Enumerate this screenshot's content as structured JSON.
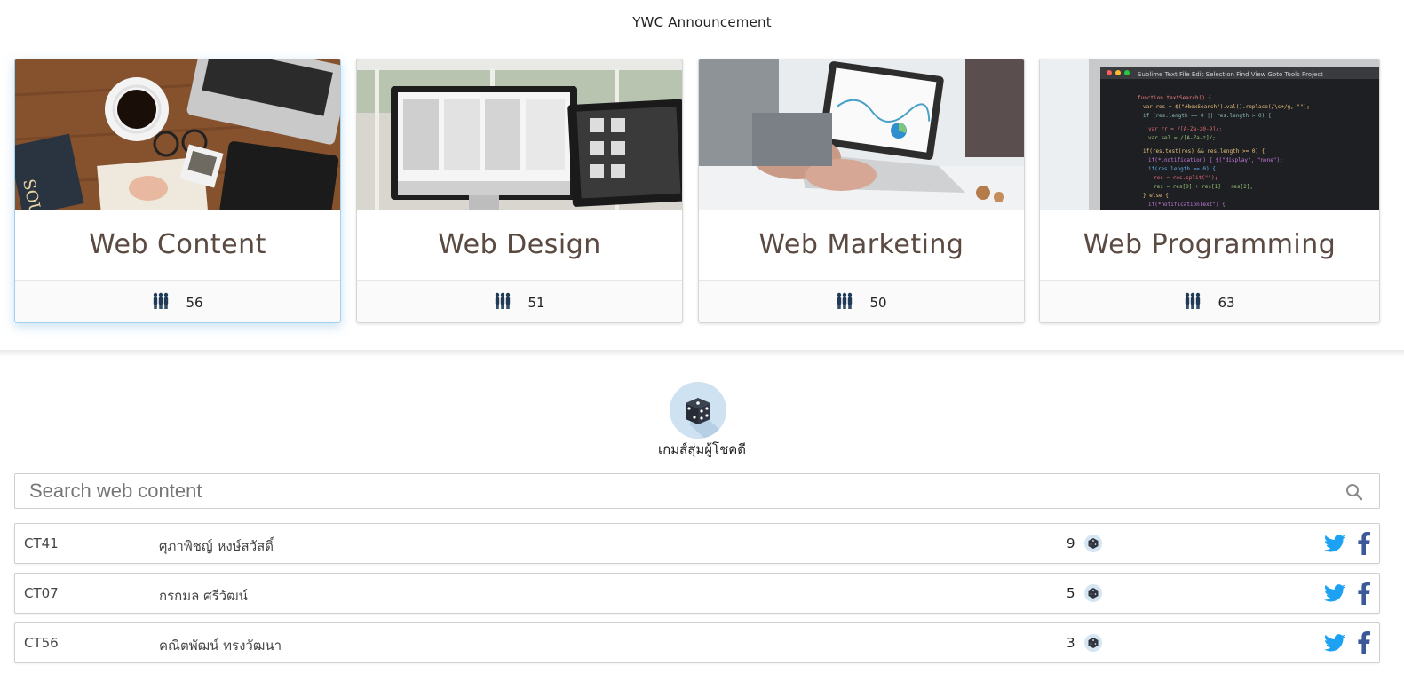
{
  "header": {
    "title": "YWC Announcement"
  },
  "majors": [
    {
      "name": "Web Content",
      "count": "56",
      "icon": "people-icon"
    },
    {
      "name": "Web Design",
      "count": "51",
      "icon": "people-icon"
    },
    {
      "name": "Web Marketing",
      "count": "50",
      "icon": "people-icon"
    },
    {
      "name": "Web Programming",
      "count": "63",
      "icon": "people-icon"
    }
  ],
  "random_game": {
    "label": "เกมส์สุ่มผู้โชคดี",
    "icon": "dice-icon"
  },
  "search": {
    "placeholder": "Search web content",
    "value": "",
    "icon": "search-icon"
  },
  "candidates": [
    {
      "id": "CT41",
      "name": "ศุภาพิชญ์ หงษ์สวัสดิ์",
      "score": "9"
    },
    {
      "id": "CT07",
      "name": "กรกมล ศรีวัฒน์",
      "score": "5"
    },
    {
      "id": "CT56",
      "name": "คณิตพัฒน์ ทรงวัฒนา",
      "score": "3"
    }
  ],
  "colors": {
    "title_text": "#5a4a42",
    "twitter": "#1da1f2",
    "facebook": "#3b5998",
    "icon_dark": "#1f3b57",
    "badge_bg": "#d5e5f2"
  }
}
